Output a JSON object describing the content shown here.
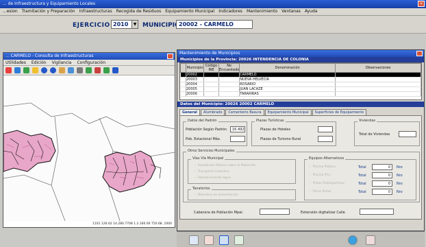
{
  "app": {
    "title": "... de Infraestructura y Equipamiento Locales",
    "menu": [
      "...esion",
      "Tramitación y Preparación",
      "Infraestructuras",
      "Recogida de Residuos",
      "Equipamiento Municipal",
      "Indicadores",
      "Mantenimiento",
      "Ventanas",
      "Ayuda"
    ]
  },
  "toolbar": {
    "ejercicio_label": "EJERCICIO",
    "ejercicio_value": "2010",
    "municipio_label": "MUNICIPIO",
    "municipio_value": "20002 - CARMELO"
  },
  "map_window": {
    "title": "... CARMELO - Consulta de Infraestructuras",
    "menu": [
      "Utilidades",
      "Edición",
      "Vigilancia",
      "Configuración"
    ],
    "coords": "1101 126.62 14.280.7708   1.2.160.00 750.68 ,1000"
  },
  "data_window": {
    "title": "Mantenimiento de Municipios",
    "grid_header": "Municipios de la Provincia: 20026 INTENDENCIA DE COLONIA",
    "grid_columns": [
      "Municipio",
      "Código INE",
      "No Encuestado",
      "Denominación",
      "Observaciones"
    ],
    "grid_rows": [
      {
        "code": "20002",
        "name": "CARMELO",
        "selected": true
      },
      {
        "code": "20003",
        "name": "NUEVA HELVECIA",
        "selected": false
      },
      {
        "code": "20004",
        "name": "ROSARIO",
        "selected": false
      },
      {
        "code": "20005",
        "name": "JUAN LACAZE",
        "selected": false
      },
      {
        "code": "20006",
        "name": "TARARIRAS",
        "selected": false
      }
    ],
    "detail_header": "Datos del Municipio: 20026 20002 CARMELO",
    "tabs": [
      "General",
      "Alumbrado",
      "Cementerio Basura",
      "Equipamiento Municipal",
      "Superficies de Equipamiento"
    ],
    "datos_padron": {
      "label": "Datos del Padrón",
      "poblacion_label": "Población Según Padrón",
      "poblacion_value": "16.492",
      "estacional_label": "Pob. Estacional Máx."
    },
    "plazas": {
      "label": "Plazas Turísticas",
      "hoteles_label": "Plazas de Hoteles",
      "rural_label": "Plazas de Turismo Rural"
    },
    "viviendas": {
      "label": "Viviendas",
      "total_label": "Total de Viviendas"
    },
    "otras": {
      "label": "Otros Servicios Municipales",
      "vias_label": "Vías Vía Municipal",
      "vias_checks": [
        "Alumbrado Público sobre el Población",
        "Transporte Colectivo",
        "Abastecimiento Agua"
      ],
      "tanatorio_label": "Tanatorios",
      "tanatorio_check": "Matadero de alimentación"
    },
    "equipos": {
      "label": "Equipos Alternativos",
      "rows": [
        "Piscina Pública",
        "Piscina Priv.",
        "Pistas Polideportivas",
        "Otras Pistas"
      ],
      "total_label": "Total",
      "total_value": "0",
      "unit": "Nro"
    },
    "cabecera_label": "Cabecera de Población Mpal.",
    "extension_label": "Extensión digitalizar Calle"
  },
  "colors": {
    "title_blue": "#1f4cb8",
    "header_navy": "#253e9a",
    "map_fill_pink": "#e8a6c8",
    "map_border": "#000000"
  }
}
